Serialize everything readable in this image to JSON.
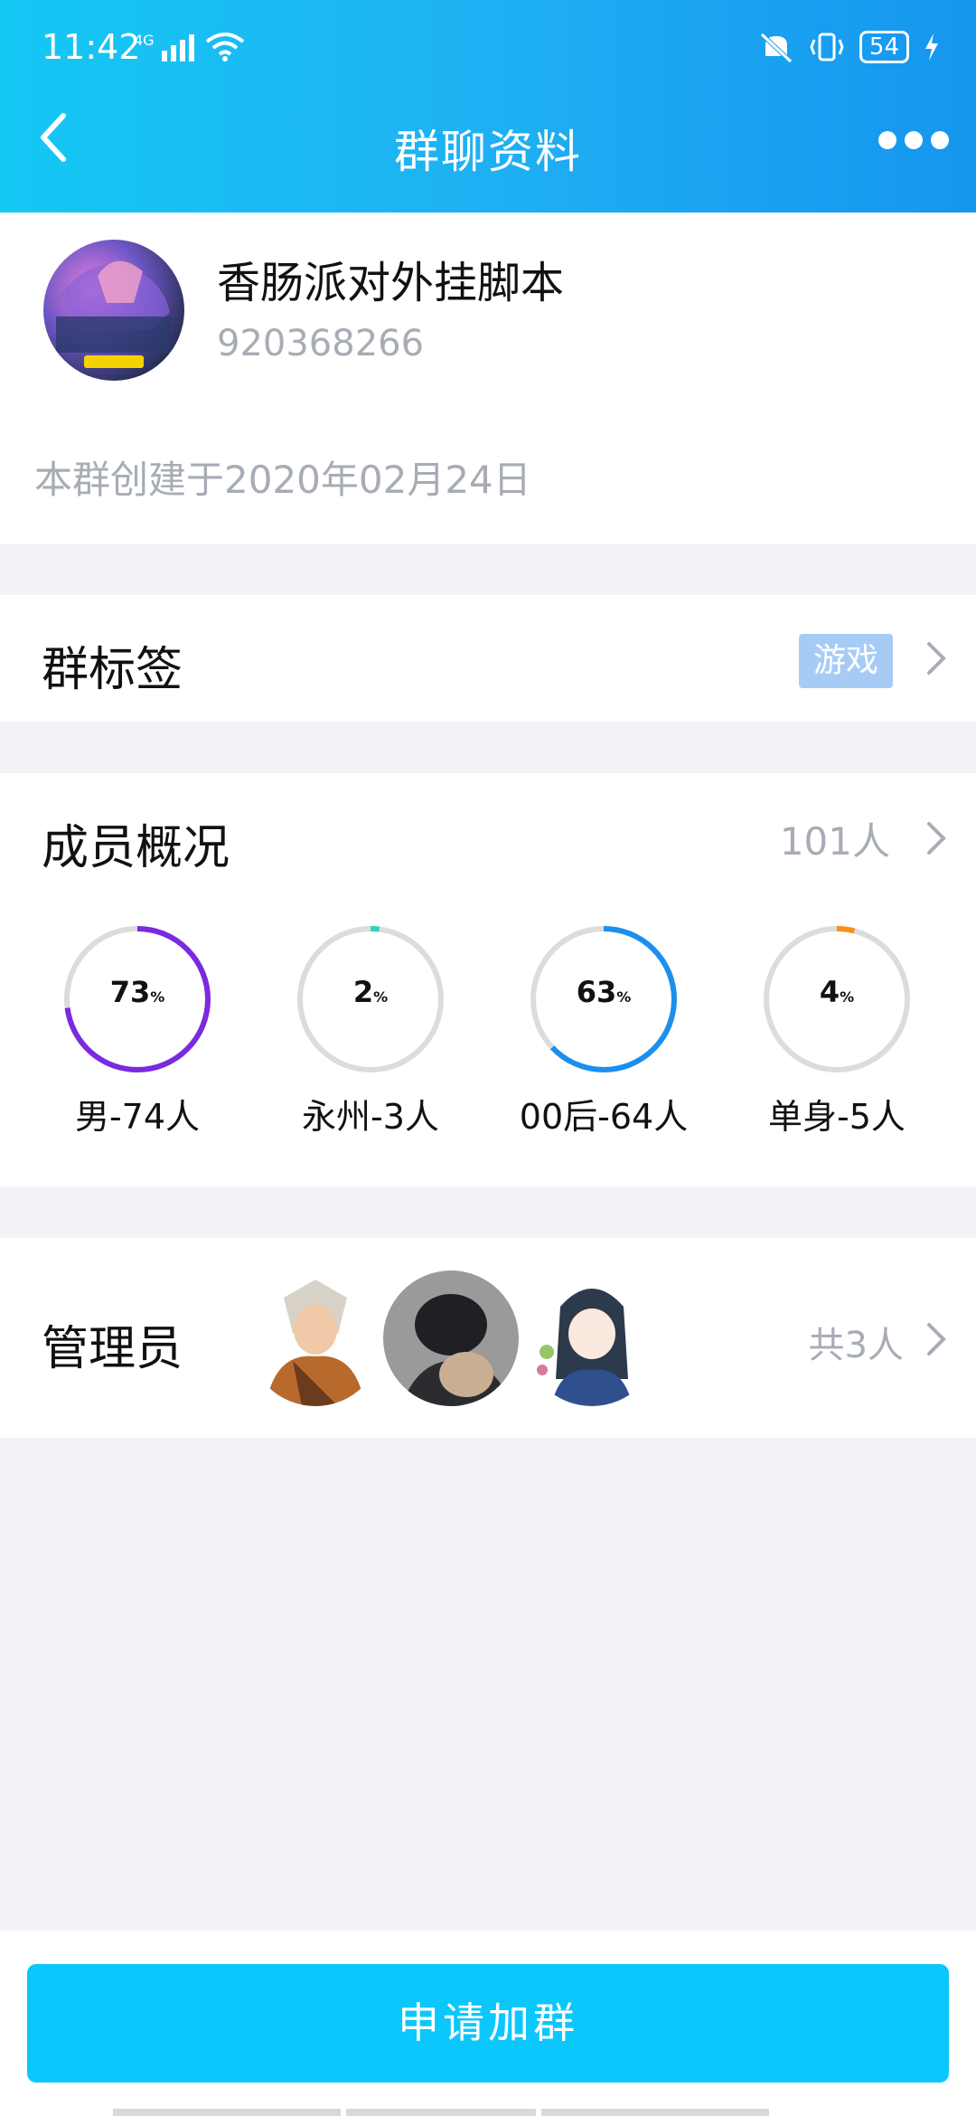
{
  "status_bar": {
    "time": "11:42",
    "network": "4G",
    "battery": "54"
  },
  "header": {
    "title": "群聊资料"
  },
  "group": {
    "name": "香肠派对外挂脚本",
    "id": "920368266",
    "created": "本群创建于2020年02月24日"
  },
  "tag_row": {
    "label": "群标签",
    "tag": "游戏"
  },
  "members": {
    "label": "成员概况",
    "count": "101人",
    "stats": [
      {
        "percent": "73",
        "label": "男-74人",
        "color": "#7a2ae0",
        "value": 0.73
      },
      {
        "percent": "2",
        "label": "永州-3人",
        "color": "#34d1c3",
        "value": 0.02
      },
      {
        "percent": "63",
        "label": "00后-64人",
        "color": "#1b8ff0",
        "value": 0.63
      },
      {
        "percent": "4",
        "label": "单身-5人",
        "color": "#f6901e",
        "value": 0.04
      }
    ]
  },
  "admins": {
    "label": "管理员",
    "count": "共3人"
  },
  "footer": {
    "join_label": "申请加群"
  },
  "colors": {
    "accent": "#0bc7fb",
    "header_start": "#14c8f4",
    "header_end": "#1596ee"
  }
}
